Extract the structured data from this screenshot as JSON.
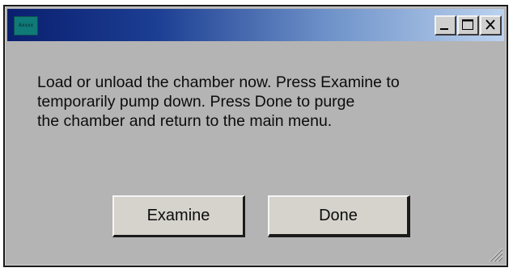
{
  "window": {
    "title_icon_label": "Axxxx",
    "controls": {
      "minimize": "minimize-icon",
      "maximize": "maximize-icon",
      "close": "close-icon"
    }
  },
  "dialog": {
    "message_lines": [
      "Load or unload the chamber now. Press Examine to",
      "temporarily pump down. Press Done to purge",
      "the chamber and return to the main menu."
    ],
    "buttons": {
      "examine": "Examine",
      "done": "Done"
    }
  },
  "colors": {
    "titlebar_start": "#0a1f6e",
    "titlebar_end": "#bcd2ef",
    "dialog_background": "#b4b4b4",
    "button_face": "#d6d3cd",
    "icon_teal": "#0f7a78"
  }
}
